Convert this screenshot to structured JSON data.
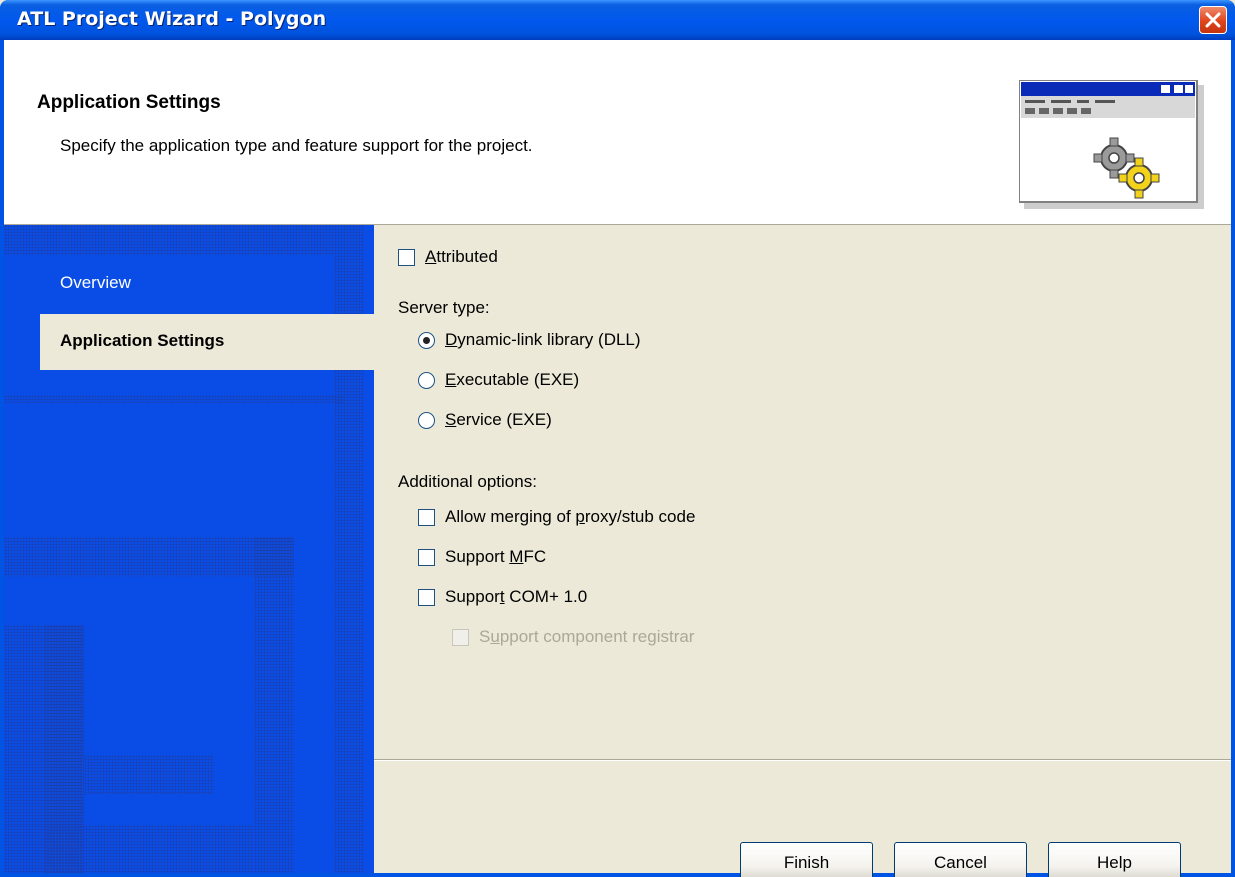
{
  "window": {
    "title": "ATL Project Wizard - Polygon"
  },
  "header": {
    "title": "Application Settings",
    "description": "Specify the application type and feature support for the project."
  },
  "nav": {
    "items": [
      {
        "label": "Overview",
        "selected": false
      },
      {
        "label": "Application Settings",
        "selected": true
      }
    ]
  },
  "options": {
    "attributed": {
      "label": "Attributed",
      "checked": false
    },
    "server_type_label": "Server type:",
    "server_types": [
      {
        "label": "Dynamic-link library (DLL)",
        "selected": true
      },
      {
        "label": "Executable (EXE)",
        "selected": false
      },
      {
        "label": "Service (EXE)",
        "selected": false
      }
    ],
    "additional_label": "Additional options:",
    "additional": [
      {
        "label": "Allow merging of proxy/stub code",
        "checked": false,
        "enabled": true
      },
      {
        "label": "Support MFC",
        "checked": false,
        "enabled": true
      },
      {
        "label": "Support COM+ 1.0",
        "checked": false,
        "enabled": true
      },
      {
        "label": "Support component registrar",
        "checked": false,
        "enabled": false
      }
    ]
  },
  "buttons": {
    "finish": "Finish",
    "cancel": "Cancel",
    "help": "Help"
  },
  "colors": {
    "titlebar": "#0058ee",
    "left_panel": "#0a4de6",
    "dialog_bg": "#ece9d8"
  },
  "icons": [
    "close-icon",
    "wizard-gear-icon"
  ]
}
